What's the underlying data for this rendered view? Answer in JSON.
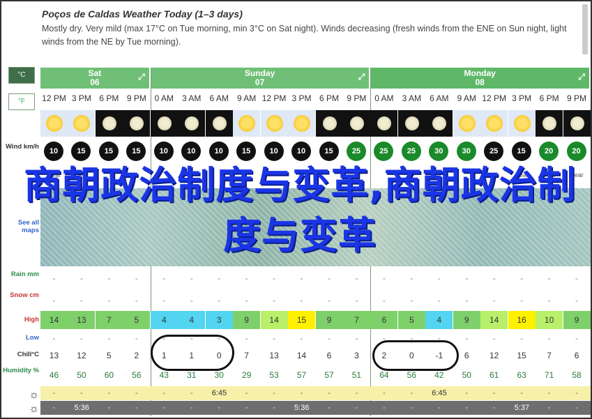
{
  "header": {
    "title": "Poços de Caldas Weather Today (1–3 days)",
    "description": "Mostly dry. Very mild (max 17°C on Tue morning, min 3°C on Sat night). Winds decreasing (fresh winds from the ENE on Sun night, light winds from the NE by Tue morning)."
  },
  "units": {
    "celsius": "°C",
    "fahrenheit": "°F"
  },
  "labels": {
    "wind": "Wind km/h",
    "see_maps": "See all maps",
    "rain": "Rain mm",
    "snow": "Snow cm",
    "high": "High",
    "low": "Low",
    "chill": "Chill°C",
    "humidity": "Humidity %"
  },
  "days": [
    {
      "name": "Sat",
      "date": "06"
    },
    {
      "name": "Sunday",
      "date": "07"
    },
    {
      "name": "Monday",
      "date": "08"
    }
  ],
  "times": [
    "12 PM",
    "3 PM",
    "6 PM",
    "9 PM",
    "0 AM",
    "3 AM",
    "6 AM",
    "9 AM",
    "12 PM",
    "3 PM",
    "6 PM",
    "9 PM",
    "0 AM",
    "3 AM",
    "6 AM",
    "9 AM",
    "12 PM",
    "3 PM",
    "6 PM",
    "9 PM"
  ],
  "sky": [
    "sun",
    "sun",
    "moon",
    "moon",
    "moon",
    "moon",
    "moon",
    "sun",
    "sun",
    "sun",
    "moon",
    "moon",
    "moon",
    "moon",
    "moon",
    "sun",
    "sun",
    "sun",
    "moon",
    "moon"
  ],
  "wind": [
    "10",
    "15",
    "15",
    "15",
    "10",
    "10",
    "10",
    "15",
    "10",
    "10",
    "15",
    "25",
    "25",
    "25",
    "30",
    "30",
    "25",
    "15",
    "20",
    "20"
  ],
  "wind_green": [
    false,
    false,
    false,
    false,
    false,
    false,
    false,
    false,
    false,
    false,
    false,
    true,
    true,
    true,
    true,
    true,
    false,
    false,
    true,
    true
  ],
  "summary_visible": [
    "clear",
    "clear",
    "",
    "",
    "",
    "",
    "",
    "",
    "",
    "",
    "",
    "",
    "",
    "",
    "",
    "",
    "",
    "clear",
    "clear",
    "clear"
  ],
  "rain": [
    "-",
    "-",
    "-",
    "-",
    "-",
    "-",
    "-",
    "-",
    "-",
    "-",
    "-",
    "-",
    "-",
    "-",
    "-",
    "-",
    "-",
    "-",
    "-",
    "-"
  ],
  "snow": [
    "-",
    "-",
    "-",
    "-",
    "-",
    "-",
    "-",
    "-",
    "-",
    "-",
    "-",
    "-",
    "-",
    "-",
    "-",
    "-",
    "-",
    "-",
    "-",
    "-"
  ],
  "high": [
    "14",
    "13",
    "7",
    "5",
    "4",
    "4",
    "3",
    "9",
    "14",
    "15",
    "9",
    "7",
    "6",
    "5",
    "4",
    "9",
    "14",
    "16",
    "10",
    "9"
  ],
  "low": [
    "-",
    "-",
    "-",
    "-",
    "-",
    "-",
    "-",
    "-",
    "-",
    "-",
    "-",
    "-",
    "-",
    "-",
    "-",
    "-",
    "-",
    "-",
    "-",
    "-"
  ],
  "chill": [
    "13",
    "12",
    "5",
    "2",
    "1",
    "1",
    "0",
    "7",
    "13",
    "14",
    "6",
    "3",
    "2",
    "0",
    "-1",
    "6",
    "12",
    "15",
    "7",
    "6"
  ],
  "humidity": [
    "46",
    "50",
    "60",
    "56",
    "43",
    "31",
    "30",
    "29",
    "53",
    "57",
    "57",
    "51",
    "64",
    "56",
    "42",
    "50",
    "61",
    "63",
    "71",
    "58"
  ],
  "sunrise": [
    "6:45",
    "6:45"
  ],
  "sunset": [
    "5:36",
    "5:36",
    "5:37"
  ],
  "dash": "-",
  "colors": {
    "day_header": "#6fbf77",
    "high_bands": [
      "#7ed06a",
      "#7ed06a",
      "#7ed06a",
      "#7ed06a",
      "#53d4f0",
      "#53d4f0",
      "#53d4f0",
      "#7ed06a",
      "#b8f06a",
      "#fff000",
      "#7ed06a",
      "#7ed06a",
      "#7ed06a",
      "#7ed06a",
      "#53d4f0",
      "#7ed06a",
      "#b8f06a",
      "#fff000",
      "#b8f06a",
      "#7ed06a"
    ]
  },
  "overlay_text": "商朝政治制度与变革,商朝政治制度与变革"
}
